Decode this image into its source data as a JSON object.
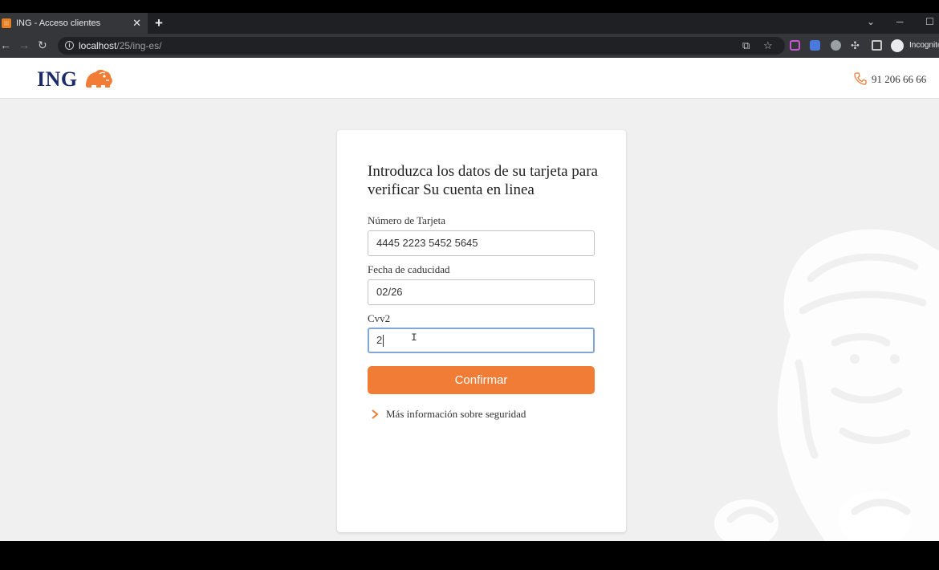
{
  "browser": {
    "tab_title": "ING - Acceso clientes",
    "tab_close": "✕",
    "new_tab": "+",
    "url_host": "localhost",
    "url_path": "/25/ing-es/",
    "profile_label": "Incognito"
  },
  "header": {
    "logo": "ING",
    "phone": "91 206 66 66"
  },
  "form": {
    "title": "Introduzca los datos de su tarjeta para verificar Su cuenta en linea",
    "card_number_label": "Número de Tarjeta",
    "card_number_value": "4445 2223 5452 5645",
    "expiry_label": "Fecha de caducidad",
    "expiry_value": "02/26",
    "cvv_label": "Cvv2",
    "cvv_value": "2",
    "confirm_label": "Confirmar",
    "more_info": "Más información sobre seguridad"
  },
  "colors": {
    "accent": "#f07c35",
    "brand_navy": "#1b2a6b",
    "focus_border": "#7fa7d8"
  }
}
